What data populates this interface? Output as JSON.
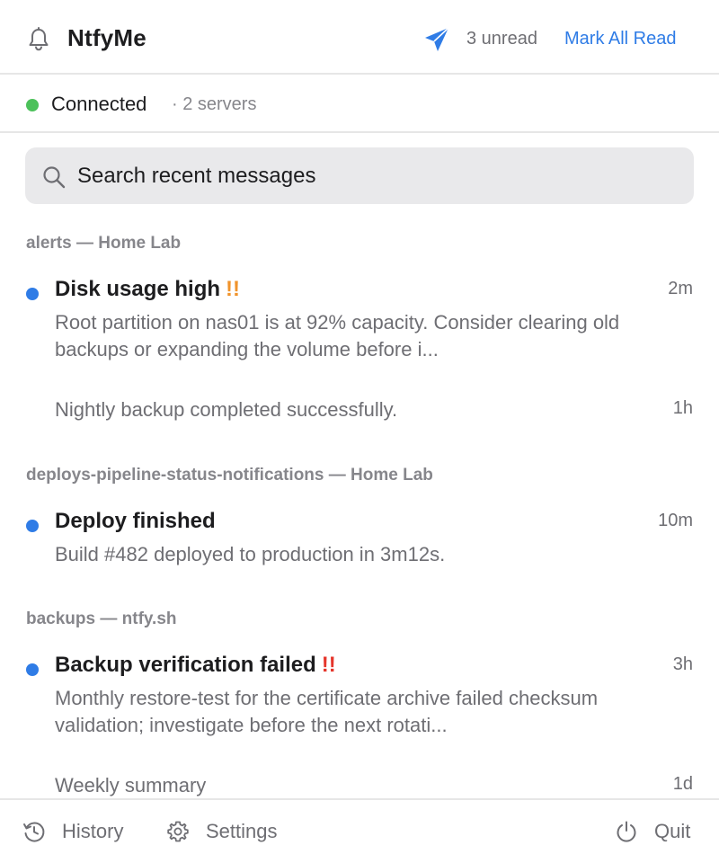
{
  "header": {
    "title": "NtfyMe",
    "unread_label": "3 unread",
    "mark_all_label": "Mark All Read"
  },
  "connection": {
    "status": "Connected",
    "servers": "· 2 servers",
    "status_color": "#4cc15a"
  },
  "search": {
    "placeholder": "Search recent messages"
  },
  "groups": [
    {
      "header": "alerts — Home Lab",
      "messages": [
        {
          "unread": true,
          "title": "Disk usage high",
          "priority": "!!",
          "priority_color": "#f0932b",
          "body": "Root partition on nas01 is at 92% capacity. Consider clearing old backups or expanding the volume before i...",
          "time": "2m"
        },
        {
          "unread": false,
          "title": "",
          "priority": "",
          "body": "Nightly backup completed successfully.",
          "time": "1h"
        }
      ]
    },
    {
      "header": "deploys-pipeline-status-notifications — Home Lab",
      "messages": [
        {
          "unread": true,
          "title": "Deploy finished",
          "priority": "",
          "body": "Build #482 deployed to production in 3m12s.",
          "time": "10m"
        }
      ]
    },
    {
      "header": "backups — ntfy.sh",
      "messages": [
        {
          "unread": true,
          "title": "Backup verification failed",
          "priority": "!!",
          "priority_color": "#e5352b",
          "body": "Monthly restore-test for the certificate archive failed checksum validation; investigate before the next rotati...",
          "time": "3h"
        },
        {
          "unread": false,
          "title": "",
          "priority": "",
          "body": "Weekly summary",
          "time": "1d"
        }
      ]
    }
  ],
  "footer": {
    "history_label": "History",
    "settings_label": "Settings",
    "quit_label": "Quit"
  },
  "colors": {
    "accent": "#2f7ce6",
    "unread_dot": "#2f7ce6",
    "priority_high": "#f0932b",
    "priority_urgent": "#e5352b"
  },
  "icons": [
    "bell-icon",
    "send-icon",
    "search-icon",
    "history-icon",
    "gear-icon",
    "power-icon"
  ]
}
